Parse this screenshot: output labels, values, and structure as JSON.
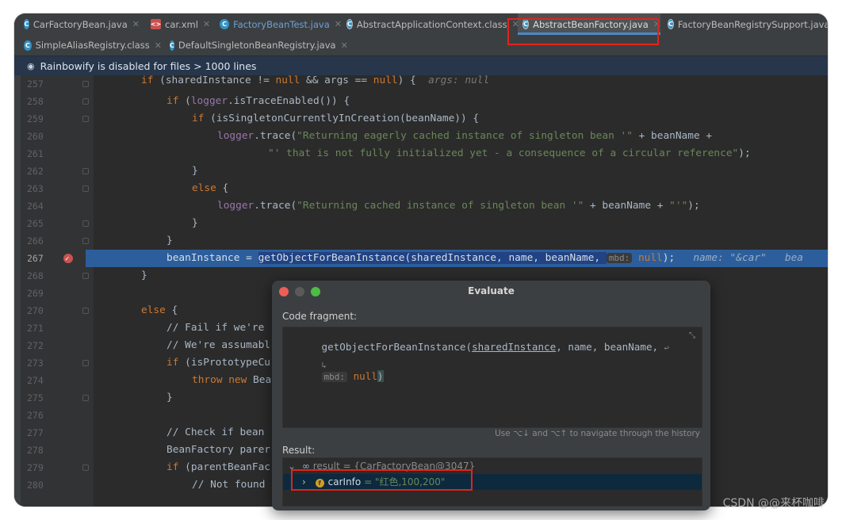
{
  "tabs_row1": [
    {
      "label": "CarFactoryBean.java",
      "icon": "class-icon"
    },
    {
      "label": "car.xml",
      "icon": "xml-icon"
    },
    {
      "label": "FactoryBeanTest.java",
      "icon": "class-icon"
    },
    {
      "label": "AbstractApplicationContext.class",
      "icon": "abstract-class-icon"
    },
    {
      "label": "AbstractBeanFactory.java",
      "icon": "abstract-class-icon"
    },
    {
      "label": "FactoryBeanRegistrySupport.java",
      "icon": "abstract-class-icon"
    }
  ],
  "tabs_row2": [
    {
      "label": "SimpleAliasRegistry.class",
      "icon": "class-icon"
    },
    {
      "label": "DefaultSingletonBeanRegistry.java",
      "icon": "class-icon"
    }
  ],
  "banner": {
    "text": "Rainbowify is disabled for files > 1000 lines"
  },
  "lines": [
    {
      "num": "257"
    },
    {
      "num": "258"
    },
    {
      "num": "259"
    },
    {
      "num": "260"
    },
    {
      "num": "261"
    },
    {
      "num": "262"
    },
    {
      "num": "263"
    },
    {
      "num": "264"
    },
    {
      "num": "265"
    },
    {
      "num": "266"
    },
    {
      "num": "267"
    },
    {
      "num": "268"
    },
    {
      "num": "269"
    },
    {
      "num": "270"
    },
    {
      "num": "271"
    },
    {
      "num": "272"
    },
    {
      "num": "273"
    },
    {
      "num": "274"
    },
    {
      "num": "275"
    },
    {
      "num": "276"
    },
    {
      "num": "277"
    },
    {
      "num": "278"
    },
    {
      "num": "279"
    },
    {
      "num": "280"
    }
  ],
  "code": {
    "l257a": "if (sharedInstance != null && args == null) {",
    "l257h": "args: null",
    "l258a": "if (",
    "l258f": "logger",
    ".": ".",
    "l258b": ".isTraceEnabled()) {",
    "l259": "if (isSingletonCurrentlyInCreation(beanName)) {",
    "l260a": "logger",
    "l260b": ".trace(",
    "l260s": "\"Returning eagerly cached instance of singleton bean '\"",
    "l260c": " + beanName +",
    "l261s": "\"' that is not fully initialized yet - a consequence of a circular reference\"",
    "l261c": ");",
    "l262": "}",
    "l263a": "}",
    "l263k": "else",
    "l263b": " {",
    "l264a": "logger",
    "l264b": ".trace(",
    "l264s": "\"Returning cached instance of singleton bean '\"",
    "l264c": " + beanName + ",
    "l264s2": "\"'\"",
    "l264d": ");",
    "l265": "}",
    "l266": "}",
    "l267a": "beanInstance = ",
    "l267b": "getObjectForBeanInstance(sharedInstance, name, beanName, ",
    "l267i": "mbd:",
    "l267k": " null",
    ");": ");",
    "l267h": "name: \"&car\"",
    "l267h2": "bea",
    "l268": "}",
    "l270k": "else",
    "l270b": " {",
    "l271": "// Fail if we're",
    "l272": "// We're assumabl",
    "l273a": "if (isPrototypeCu",
    "l274k": "throw new",
    "l274b": " Bea",
    "l275": "}",
    "l277": "// Check if bean",
    "l278": "BeanFactory parer",
    "l279": "if (parentBeanFac",
    "l280": "// Not found"
  },
  "dialog": {
    "title": "Evaluate",
    "fragment_label": "Code fragment:",
    "fragment_line1": "getObjectForBeanInstance(",
    "fragment_arg1": "sharedInstance",
    "fragment_rest": ", name, beanName, ",
    "fragment_hint": "mbd:",
    "fragment_null": " null",
    "fragment_close": ")",
    "history_hint": "Use ⌥↓ and ⌥↑ to navigate through the history",
    "result_label": "Result:",
    "result_row": "result = {CarFactoryBean@3047}",
    "field_name": "carInfo",
    "field_value": " = \"红色,100,200\""
  },
  "watermark": "CSDN @@来杯咖啡",
  "colors": {
    "accent": "#4a88c7",
    "highlight": "#2d5e9c",
    "annotation": "#e2231a"
  }
}
